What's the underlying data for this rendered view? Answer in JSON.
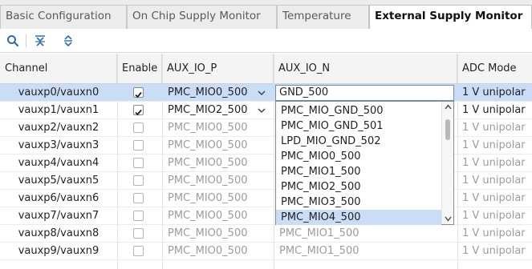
{
  "tabs": [
    {
      "label": "Basic Configuration"
    },
    {
      "label": "On Chip Supply Monitor"
    },
    {
      "label": "Temperature"
    },
    {
      "label": "External Supply Monitor"
    }
  ],
  "columns": {
    "channel": "Channel",
    "enable": "Enable",
    "aux_p": "AUX_IO_P",
    "aux_n": "AUX_IO_N",
    "adc": "ADC Mode"
  },
  "rows": [
    {
      "channel": "vauxp0/vauxn0",
      "enabled": true,
      "aux_p": "PMC_MIO0_500",
      "aux_n": "GND_500",
      "adc": "1 V unipolar"
    },
    {
      "channel": "vauxp1/vauxn1",
      "enabled": true,
      "aux_p": "PMC_MIO2_500",
      "aux_n": "",
      "adc": "1 V unipolar"
    },
    {
      "channel": "vauxp2/vauxn2",
      "enabled": false,
      "aux_p": "PMC_MIO0_500",
      "aux_n": "",
      "adc": "1 V unipolar"
    },
    {
      "channel": "vauxp3/vauxn3",
      "enabled": false,
      "aux_p": "PMC_MIO0_500",
      "aux_n": "",
      "adc": "1 V unipolar"
    },
    {
      "channel": "vauxp4/vauxn4",
      "enabled": false,
      "aux_p": "PMC_MIO0_500",
      "aux_n": "",
      "adc": "1 V unipolar"
    },
    {
      "channel": "vauxp5/vauxn5",
      "enabled": false,
      "aux_p": "PMC_MIO0_500",
      "aux_n": "",
      "adc": "1 V unipolar"
    },
    {
      "channel": "vauxp6/vauxn6",
      "enabled": false,
      "aux_p": "PMC_MIO0_500",
      "aux_n": "",
      "adc": "1 V unipolar"
    },
    {
      "channel": "vauxp7/vauxn7",
      "enabled": false,
      "aux_p": "PMC_MIO0_500",
      "aux_n": "",
      "adc": "1 V unipolar"
    },
    {
      "channel": "vauxp8/vauxn8",
      "enabled": false,
      "aux_p": "PMC_MIO0_500",
      "aux_n": "PMC_MIO1_500",
      "adc": "1 V unipolar"
    },
    {
      "channel": "vauxp9/vauxn9",
      "enabled": false,
      "aux_p": "PMC_MIO0_500",
      "aux_n": "PMC_MIO1_500",
      "adc": "1 V unipolar"
    }
  ],
  "dropdown_options": [
    "PMC_MIO_GND_500",
    "PMC_MIO_GND_501",
    "LPD_MIO_GND_502",
    "PMC_MIO0_500",
    "PMC_MIO1_500",
    "PMC_MIO2_500",
    "PMC_MIO3_500",
    "PMC_MIO4_500"
  ],
  "dropdown_selected": "PMC_MIO4_500",
  "icons": {
    "search": "search-icon",
    "collapse": "collapse-all-icon",
    "expand": "expand-all-icon"
  }
}
